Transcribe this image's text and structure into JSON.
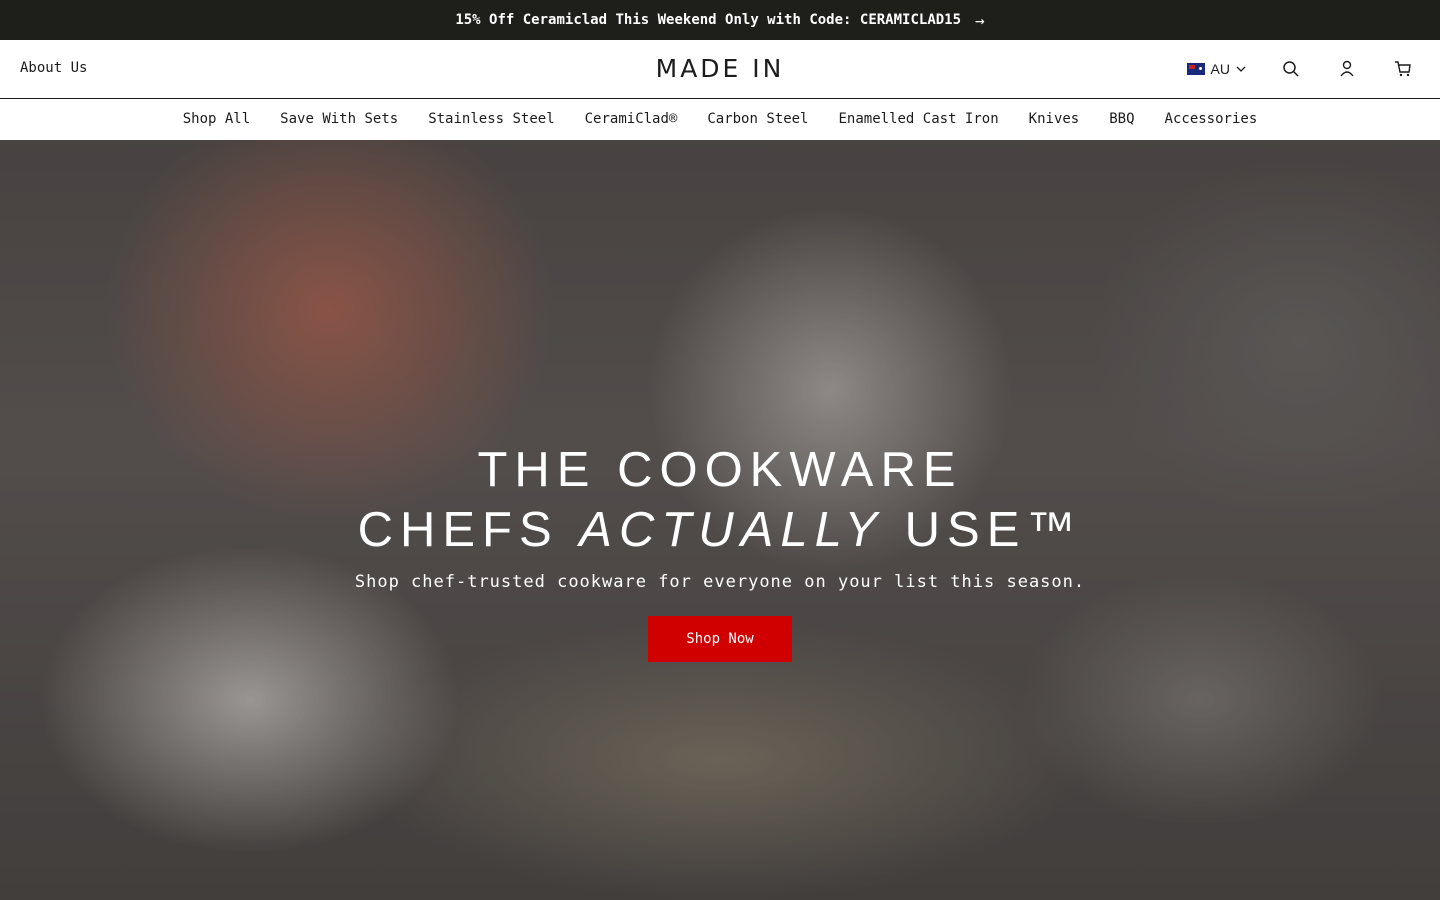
{
  "promo": {
    "text": "15% Off Ceramiclad This Weekend Only with Code: CERAMICLAD15",
    "arrow": "→"
  },
  "header": {
    "about": "About Us",
    "logo": "MADE IN",
    "locale": "AU"
  },
  "nav": {
    "items": [
      "Shop All",
      "Save With Sets",
      "Stainless Steel",
      "CeramiClad®",
      "Carbon Steel",
      "Enamelled Cast Iron",
      "Knives",
      "BBQ",
      "Accessories"
    ]
  },
  "hero": {
    "line1": "THE COOKWARE",
    "line2_pre": "CHEFS ",
    "line2_em": "ACTUALLY",
    "line2_post": " USE™",
    "subtitle": "Shop chef-trusted cookware for everyone on your list this season.",
    "cta": "Shop Now"
  },
  "icons": [
    "search-icon",
    "account-icon",
    "cart-icon",
    "chevron-down-icon",
    "arrow-right-icon",
    "flag-icon"
  ],
  "colors": {
    "promo_bg": "#1e1e1b",
    "cta_bg": "#d10000"
  }
}
